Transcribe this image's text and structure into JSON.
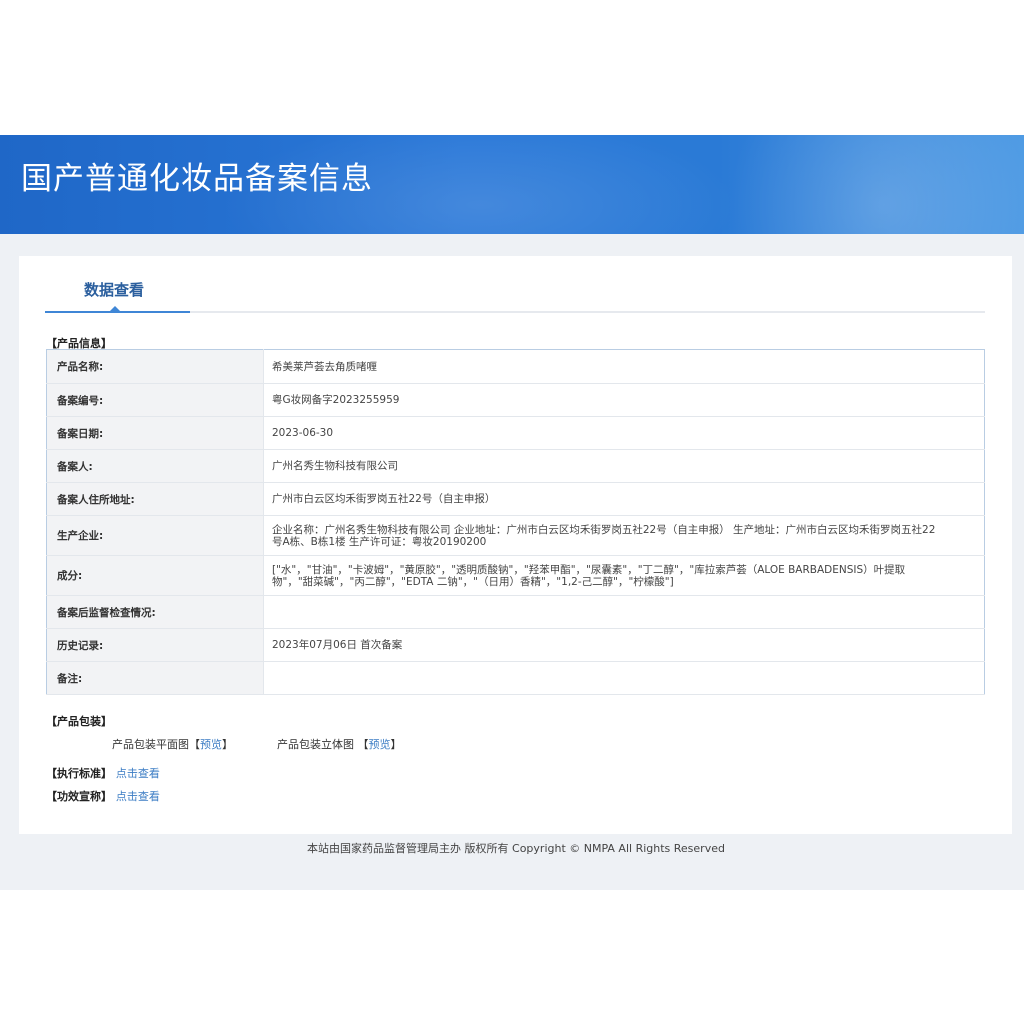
{
  "header": {
    "title": "国产普通化妆品备案信息"
  },
  "tabs": [
    {
      "label": "数据查看"
    }
  ],
  "sections": {
    "product_info": "【产品信息】",
    "packaging": "【产品包装】",
    "standard": "【执行标准】",
    "efficacy": "【功效宣称】"
  },
  "product_info": [
    {
      "key": "产品名称:",
      "value": "希美莱芦荟去角质啫喱"
    },
    {
      "key": "备案编号:",
      "value": "粤G妆网备字2023255959"
    },
    {
      "key": "备案日期:",
      "value": "2023-06-30"
    },
    {
      "key": "备案人:",
      "value": "广州名秀生物科技有限公司"
    },
    {
      "key": "备案人住所地址:",
      "value": "广州市白云区均禾街罗岗五社22号（自主申报）"
    },
    {
      "key": "生产企业:",
      "value": "企业名称：广州名秀生物科技有限公司 企业地址：广州市白云区均禾街罗岗五社22号（自主申报） 生产地址：广州市白云区均禾街罗岗五社22号A栋、B栋1楼 生产许可证：粤妆20190200"
    },
    {
      "key": "成分:",
      "value": "[\"水\"，\"甘油\"，\"卡波姆\"，\"黄原胶\"，\"透明质酸钠\"，\"羟苯甲酯\"，\"尿囊素\"，\"丁二醇\"，\"库拉索芦荟（ALOE BARBADENSIS）叶提取物\"，\"甜菜碱\"，\"丙二醇\"，\"EDTA 二钠\"，\"（日用）香精\"，\"1,2-己二醇\"，\"柠檬酸\"]"
    },
    {
      "key": "备案后监督检查情况:",
      "value": ""
    },
    {
      "key": "历史记录:",
      "value": "2023年07月06日 首次备案"
    },
    {
      "key": "备注:",
      "value": ""
    }
  ],
  "packaging": {
    "flat_label": "产品包装平面图",
    "flat_link": "预览",
    "solid_label": "产品包装立体图",
    "solid_link": "预览",
    "bracket_open": "【",
    "bracket_close": "】"
  },
  "links": {
    "standard": "点击查看",
    "efficacy": "点击查看"
  },
  "footer": {
    "text": "本站由国家药品监督管理局主办 版权所有 Copyright © NMPA All Rights Reserved"
  }
}
